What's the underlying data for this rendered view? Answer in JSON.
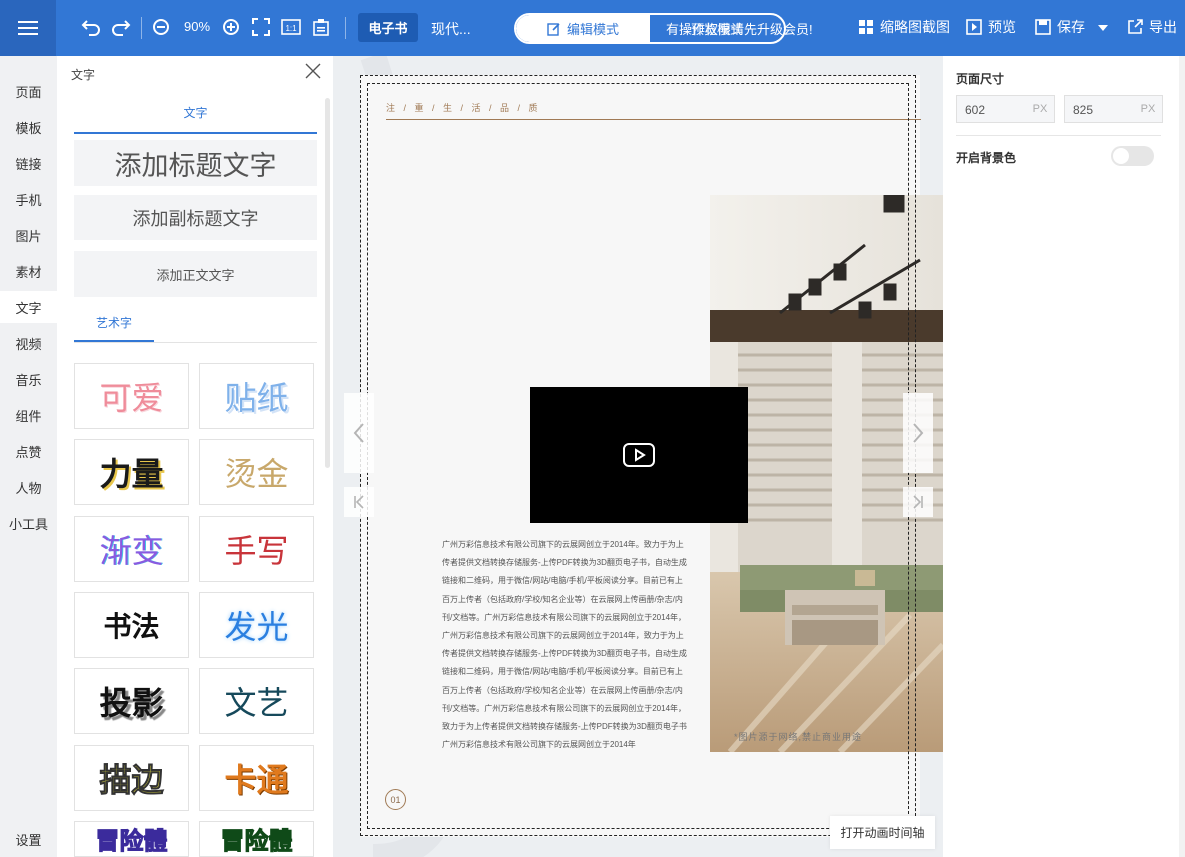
{
  "toolbar": {
    "zoom": "90%",
    "tab_ebook": "电子书",
    "tab_modern": "现代...",
    "mode_edit": "编辑模式",
    "mode_preview": "预览模式",
    "upgrade_note": "有操作权限请先升级会员!",
    "thumbnail": "缩略图截图",
    "preview": "预览",
    "save": "保存",
    "export": "导出"
  },
  "leftnav": {
    "items": [
      "页面",
      "模板",
      "链接",
      "手机",
      "图片",
      "素材",
      "文字",
      "视频",
      "音乐",
      "组件",
      "点赞",
      "人物",
      "小工具"
    ],
    "active": "文字",
    "settings": "设置"
  },
  "panel": {
    "title": "文字",
    "tab": "文字",
    "add_title": "添加标题文字",
    "add_subtitle": "添加副标题文字",
    "add_body": "添加正文文字",
    "art_tab": "艺术字",
    "art_items": [
      "可爱",
      "贴纸",
      "力量",
      "烫金",
      "渐变",
      "手写",
      "书法",
      "发光",
      "投影",
      "文艺",
      "描边",
      "卡通",
      "冒险體",
      "冒险體"
    ]
  },
  "canvas": {
    "tagline": "注 / 重 / 生 / 活 / 品 / 质",
    "body_text": "广州万彩信息技术有限公司旗下的云展网创立于2014年。致力于为上传者提供文档转换存储服务-上传PDF转换为3D翻页电子书，自动生成链接和二维码，用于微信/网站/电脑/手机/平板阅读分享。目前已有上百万上传者（包括政府/学校/知名企业等）在云展网上传画册/杂志/内刊/文档等。广州万彩信息技术有限公司旗下的云展网创立于2014年，广州万彩信息技术有限公司旗下的云展网创立于2014年，致力于为上传者提供文档转换存储服务-上传PDF转换为3D翻页电子书，自动生成链接和二维码，用于微信/网站/电脑/手机/平板阅读分享。目前已有上百万上传者（包括政府/学校/知名企业等）在云展网上传画册/杂志/内刊/文档等。广州万彩信息技术有限公司旗下的云展网创立于2014年，致力于为上传者提供文档转换存储服务-上传PDF转换为3D翻页电子书广州万彩信息技术有限公司旗下的云展网创立于2014年",
    "photo_caption": "*图片源于网络,禁止商业用途",
    "page_number": "01",
    "timeline_button": "打开动画时间轴"
  },
  "rightpanel": {
    "page_size_label": "页面尺寸",
    "width": "602",
    "height": "825",
    "unit": "PX",
    "bg_label": "开启背景色",
    "bg_enabled": false
  },
  "colors": {
    "accent": "#3277d5",
    "tagline": "#a07a55"
  }
}
